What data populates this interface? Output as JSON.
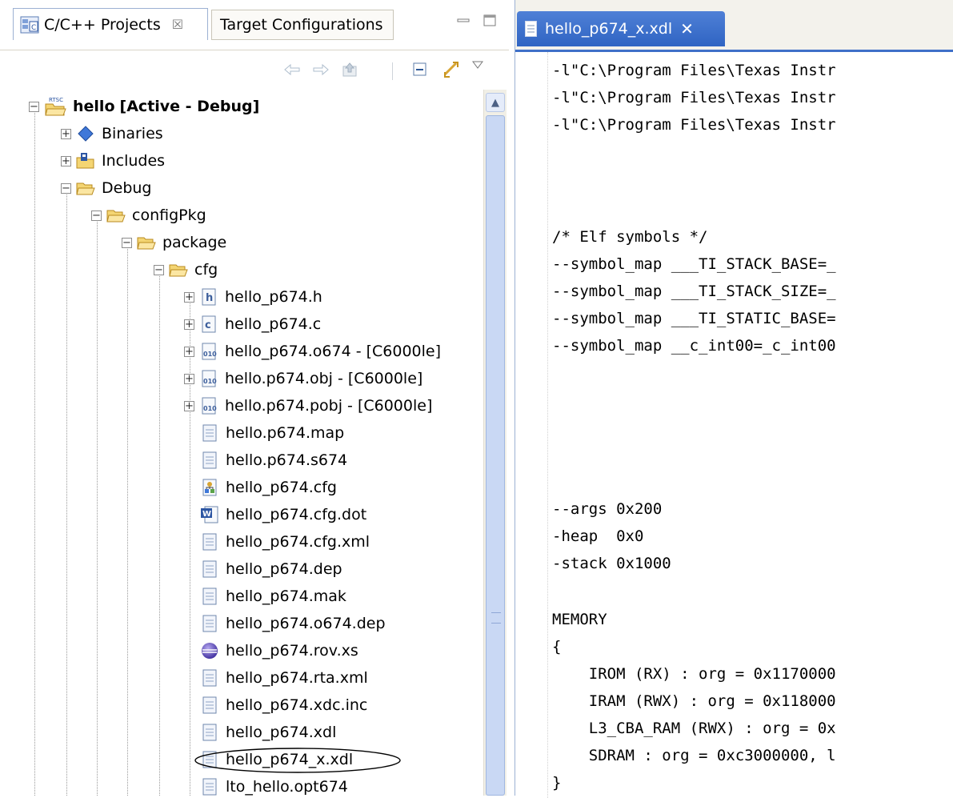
{
  "left_panel": {
    "tabs": [
      {
        "label": "C/C++ Projects",
        "close": "☒"
      },
      {
        "label": "Target Configurations"
      }
    ],
    "minimize_icon": "minimize-icon",
    "maximize_icon": "maximize-icon"
  },
  "toolbar": {
    "back": "back-icon",
    "forward": "forward-icon",
    "up": "up-icon",
    "collapse_all": "collapse-all-icon",
    "link": "link-editor-icon",
    "menu": "view-menu-icon"
  },
  "tree": {
    "project": {
      "name": "hello",
      "state": "[Active - Debug]",
      "nature": "RTSC"
    },
    "items": [
      {
        "label": "Binaries"
      },
      {
        "label": "Includes"
      },
      {
        "label": "Debug"
      },
      {
        "label": "configPkg"
      },
      {
        "label": "package"
      },
      {
        "label": "cfg"
      },
      {
        "label": "hello_p674.h"
      },
      {
        "label": "hello_p674.c"
      },
      {
        "label": "hello_p674.o674 - [C6000le]"
      },
      {
        "label": "hello.p674.obj - [C6000le]"
      },
      {
        "label": "hello.p674.pobj - [C6000le]"
      },
      {
        "label": "hello.p674.map"
      },
      {
        "label": "hello.p674.s674"
      },
      {
        "label": "hello_p674.cfg"
      },
      {
        "label": "hello_p674.cfg.dot"
      },
      {
        "label": "hello_p674.cfg.xml"
      },
      {
        "label": "hello_p674.dep"
      },
      {
        "label": "hello_p674.mak"
      },
      {
        "label": "hello_p674.o674.dep"
      },
      {
        "label": "hello_p674.rov.xs"
      },
      {
        "label": "hello_p674.rta.xml"
      },
      {
        "label": "hello_p674.xdc.inc"
      },
      {
        "label": "hello_p674.xdl"
      },
      {
        "label": "hello_p674_x.xdl"
      },
      {
        "label": "lto_hello.opt674"
      }
    ]
  },
  "editor": {
    "tab_title": "hello_p674_x.xdl",
    "tab_close": "✕",
    "lines": [
      "-l\"C:\\Program Files\\Texas Instr",
      "-l\"C:\\Program Files\\Texas Instr",
      "-l\"C:\\Program Files\\Texas Instr",
      "/* Elf symbols */",
      "--symbol_map ___TI_STACK_BASE=_",
      "--symbol_map ___TI_STACK_SIZE=_",
      "--symbol_map ___TI_STATIC_BASE=",
      "--symbol_map __c_int00=_c_int00",
      "--args 0x200",
      "-heap  0x0",
      "-stack 0x1000",
      "MEMORY",
      "{",
      "    IROM (RX) : org = 0x1170000",
      "    IRAM (RWX) : org = 0x118000",
      "    L3_CBA_RAM (RWX) : org = 0x",
      "    SDRAM : org = 0xc3000000, l",
      "}"
    ]
  },
  "colors": {
    "accent": "#2f64c3",
    "highlight_ellipse": "#000000"
  }
}
